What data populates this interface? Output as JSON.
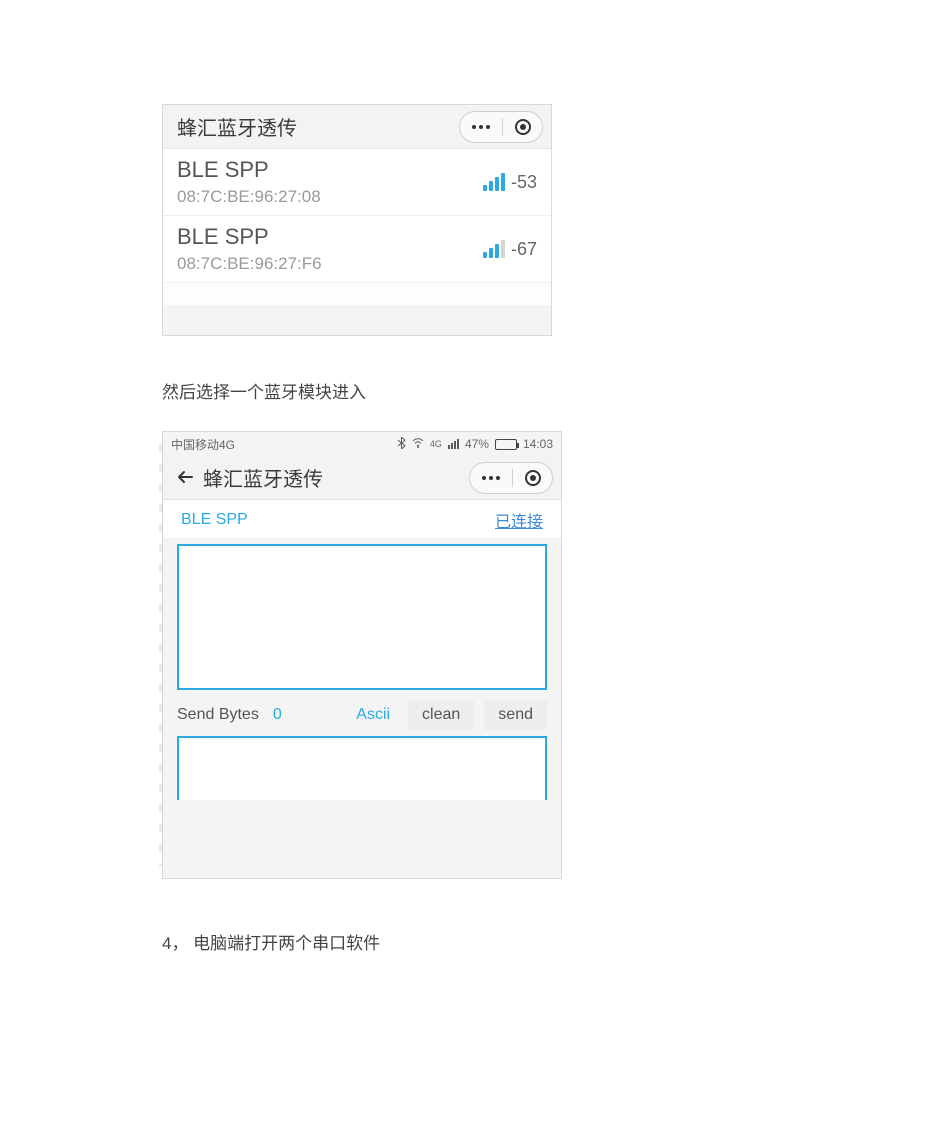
{
  "screenshot1": {
    "title": "蜂汇蓝牙透传",
    "devices": [
      {
        "name": "BLE SPP",
        "mac": "08:7C:BE:96:27:08",
        "rssi": "-53",
        "strength": "strong"
      },
      {
        "name": "BLE SPP",
        "mac": "08:7C:BE:96:27:F6",
        "rssi": "-67",
        "strength": "medium"
      }
    ]
  },
  "caption1": "然后选择一个蓝牙模块进入",
  "screenshot2": {
    "status": {
      "carrier": "中国移动4G",
      "net_label": "4G",
      "battery_pct": "47%",
      "time": "14:03"
    },
    "title": "蜂汇蓝牙透传",
    "device_name": "BLE SPP",
    "connection_state": "已连接",
    "send_bytes_label": "Send Bytes",
    "send_bytes_value": "0",
    "encoding": "Ascii",
    "clean_label": "clean",
    "send_label": "send"
  },
  "caption2": "4，  电脑端打开两个串口软件"
}
